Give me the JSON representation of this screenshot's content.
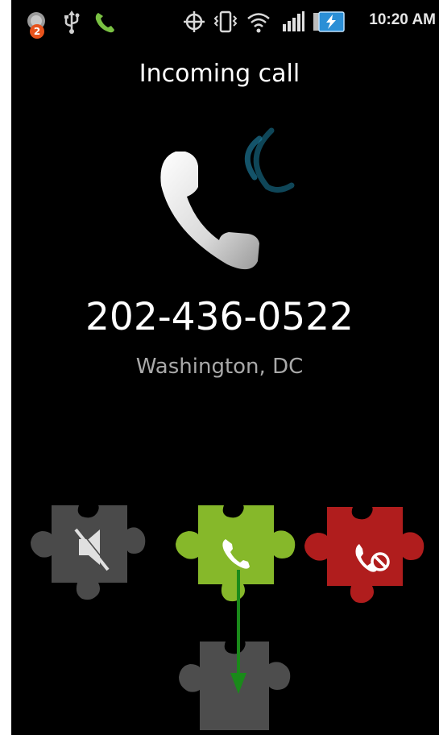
{
  "status_bar": {
    "notification_count": "2",
    "time": "10:20 AM",
    "icons": [
      "notification-icon",
      "usb-icon",
      "call-in-progress-icon",
      "gps-icon",
      "vibrate-icon",
      "wifi-icon",
      "signal-icon",
      "battery-charging-icon"
    ]
  },
  "call": {
    "title": "Incoming call",
    "number": "202-436-0522",
    "location": "Washington, DC"
  },
  "actions": [
    {
      "name": "mute",
      "icon": "mute-icon",
      "color": "#4a4a4a"
    },
    {
      "name": "answer",
      "icon": "phone-icon",
      "color": "#86b82a"
    },
    {
      "name": "decline",
      "icon": "decline-call-icon",
      "color": "#b01d1d"
    },
    {
      "name": "drag-target",
      "icon": "puzzle-slot-icon",
      "color": "#4d4d4d"
    }
  ],
  "colors": {
    "background": "#000000",
    "answer_green": "#86b82a",
    "decline_red": "#b01d1d",
    "arrow_green": "#1a8a1a",
    "ring_blue": "#1b6f8c"
  }
}
